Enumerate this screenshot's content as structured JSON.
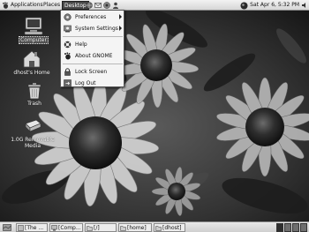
{
  "top_panel": {
    "menus": [
      "Applications",
      "Places",
      "Desktop"
    ],
    "launchers": [
      "browser-icon",
      "mail-icon",
      "network-icon",
      "person-icon"
    ],
    "clock": "Sat Apr 6, 5:32 PM"
  },
  "desktop_menu": {
    "items": [
      {
        "label": "Preferences",
        "icon": "preferences-icon",
        "submenu": true
      },
      {
        "label": "System Settings",
        "icon": "system-settings-icon",
        "submenu": true
      },
      {
        "label": "Help",
        "icon": "help-icon",
        "submenu": false
      },
      {
        "label": "About GNOME",
        "icon": "gnome-foot-icon",
        "submenu": false
      },
      {
        "label": "Lock Screen",
        "icon": "lock-icon",
        "submenu": false
      },
      {
        "label": "Log Out",
        "icon": "logout-icon",
        "submenu": false
      }
    ]
  },
  "desktop_icons": [
    {
      "label": "Computer",
      "icon": "computer-icon"
    },
    {
      "label": "dhost's Home",
      "icon": "home-folder-icon"
    },
    {
      "label": "Trash",
      "icon": "trash-icon"
    },
    {
      "label": "1.0G Removable",
      "label2": "Media",
      "icon": "removable-media-icon"
    }
  ],
  "taskbar": {
    "tasks": [
      "[The ...",
      "[Comp...",
      "[/]",
      "[home]",
      "[dhost]"
    ],
    "workspaces": 4
  },
  "colors": {
    "menu_bg": "#f4f4f4",
    "panel_bg": "#dcdcdc",
    "active_menu": "#4a4a4a"
  }
}
